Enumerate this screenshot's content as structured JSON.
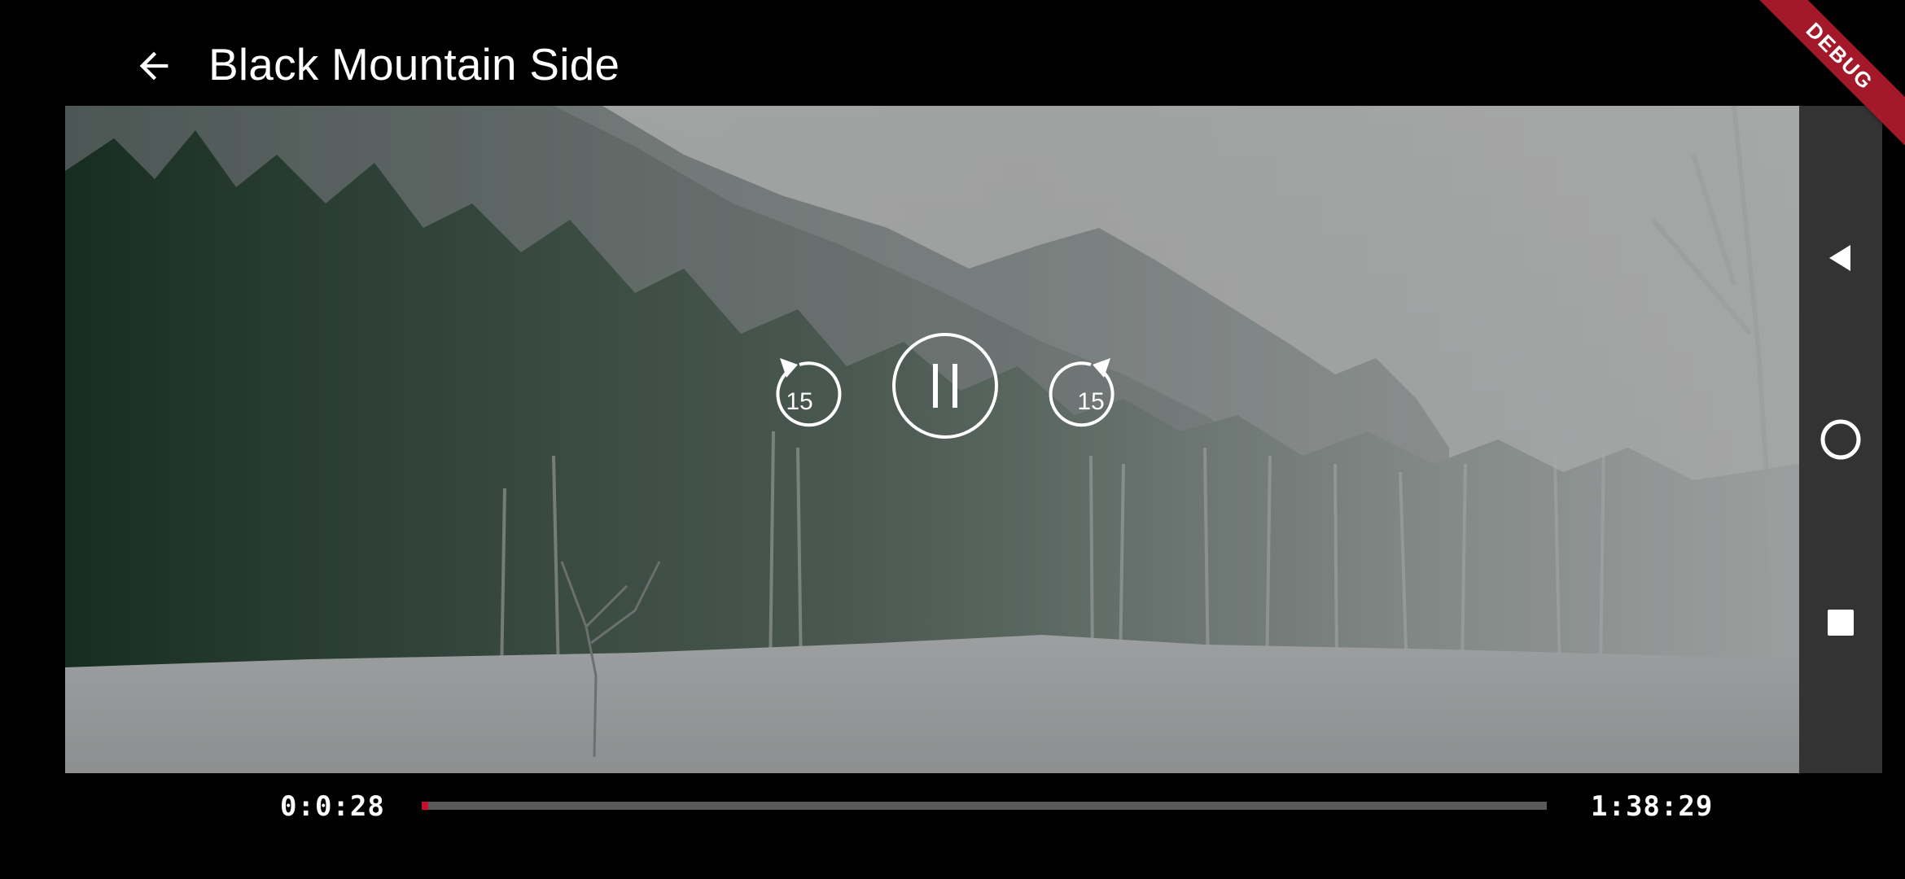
{
  "header": {
    "title": "Black Mountain Side",
    "back_icon": "arrow-back-icon"
  },
  "debug_banner": {
    "label": "DEBUG",
    "color": "#a4192a"
  },
  "player": {
    "state": "playing",
    "rewind": {
      "icon": "replay-15-icon",
      "seconds": "15"
    },
    "play_pause": {
      "icon": "pause-icon"
    },
    "forward": {
      "icon": "forward-15-icon",
      "seconds": "15"
    },
    "position": "0:0:28",
    "duration": "1:38:29",
    "progress_fraction": 0.0047,
    "progress_color": "#c8102e",
    "track_color": "#5a5a5a"
  },
  "system_nav": {
    "back_icon": "nav-back-triangle-icon",
    "home_icon": "nav-home-circle-icon",
    "recents_icon": "nav-recents-square-icon"
  }
}
